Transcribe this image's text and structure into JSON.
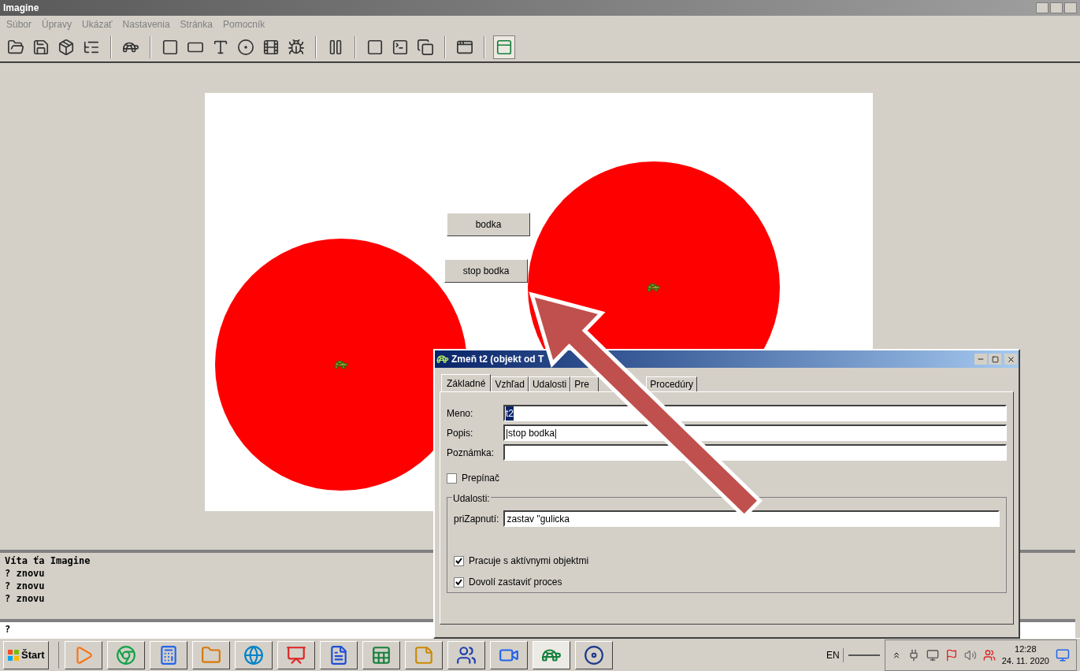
{
  "window": {
    "title": "Imagine"
  },
  "menu": [
    "Súbor",
    "Úpravy",
    "Ukázať",
    "Nastavenia",
    "Stránka",
    "Pomocník"
  ],
  "toolbar": [
    {
      "pressed": false
    },
    {
      "pressed": false
    },
    {
      "pressed": false
    },
    {
      "pressed": false
    },
    {
      "pressed": false
    },
    {
      "pressed": false
    },
    {
      "pressed": false
    },
    {
      "pressed": false
    },
    {
      "pressed": false
    },
    {
      "pressed": false
    },
    {
      "pressed": false
    },
    {
      "pressed": false
    },
    {
      "pressed": false
    },
    {
      "pressed": false
    },
    {
      "pressed": false
    },
    {
      "pressed": false
    },
    {
      "pressed": true
    }
  ],
  "canvas": {
    "buttons": [
      "bodka",
      "stop bodka"
    ]
  },
  "console": {
    "lines": [
      "Víta ťa Imagine",
      "? znovu",
      "? znovu",
      "? znovu"
    ],
    "prompt": "?"
  },
  "dialog": {
    "title": "Zmeň t2 (objekt od T",
    "tabs": [
      {
        "label": "Základné",
        "selected": true
      },
      {
        "label": "Vzhľad",
        "selected": false
      },
      {
        "label": "Udalosti",
        "selected": false
      },
      {
        "label": "Pre",
        "selected": false
      },
      {
        "label": "Procedúry",
        "selected": false
      }
    ],
    "fields": [
      {
        "label": "Meno:",
        "value": "t2",
        "highlighted": true
      },
      {
        "label": "Popis:",
        "value": "|stop bodka|",
        "highlighted": false
      },
      {
        "label": "Poznámka:"
      }
    ],
    "toggle": {
      "label": "Prepínač",
      "checked": false
    },
    "group": {
      "title": "Udalosti:",
      "event": {
        "label": "priZapnutí:",
        "value": "zastav \"gulicka"
      },
      "options": [
        {
          "label": "Pracuje s aktívnymi objektmi",
          "checked": true
        },
        {
          "label": "Dovolí zastaviť proces",
          "checked": true
        }
      ]
    }
  },
  "taskbar": {
    "start": "Štart",
    "language": "EN",
    "time": "12:28",
    "date": "24. 11. 2020"
  }
}
